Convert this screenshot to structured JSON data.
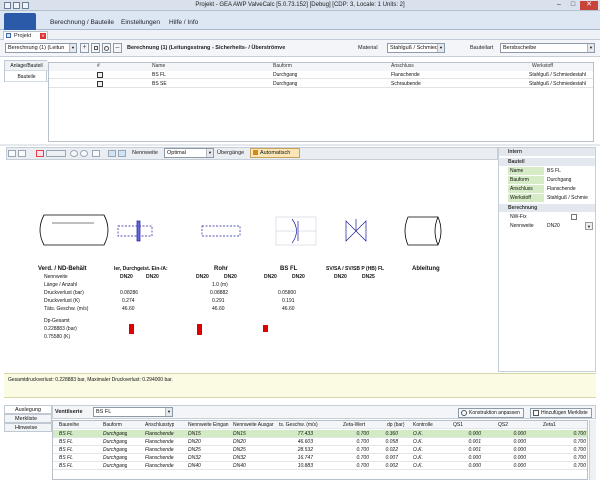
{
  "window": {
    "title": "Projekt - GEA AWP ValveCalc [5.0.73.152] [Debug] [CDP: 3, Locale: 1 Units: 2]",
    "minimize": "–",
    "maximize": "□",
    "close": "✕"
  },
  "menu": {
    "items": [
      "Berechnung / Bauteile",
      "Einstellungen",
      "Hilfe / Info"
    ]
  },
  "doc_tab": {
    "label": "Projekt",
    "close": "✕"
  },
  "project_bar": {
    "calc_select": "Berechnung (1) (Leitun",
    "plus": "+",
    "minus": "–",
    "heading": "Berechnung (1) (Leitungsstrang - Sicherheits- / Überströmve",
    "material_label": "Material",
    "material_value": "Stahlguß / Schmied",
    "bauteil_label": "Bauteilart",
    "bauteil_value": "Bersbscheibe"
  },
  "side_tabs": [
    "Anlage/Bauteil",
    "Bauteile"
  ],
  "parts_table": {
    "headers": [
      "#",
      "Name",
      "Bauform",
      "Anschluss",
      "Werkstoff"
    ],
    "rows": [
      {
        "name": "BS FL",
        "bauform": "Durchgang",
        "anschluss": "Flanschende",
        "werkstoff": "Stahlguß / Schmiedestahl"
      },
      {
        "name": "BS SE",
        "bauform": "Durchgang",
        "anschluss": "Schraubende",
        "werkstoff": "Stahlguß / Schmiedestahl"
      }
    ]
  },
  "toolbar": {
    "nennweite_label": "Nennweite",
    "nennweite_value": "Optimal",
    "uebergaenge_label": "Übergänge",
    "auto_label": "Automatisch"
  },
  "diagram": {
    "col1": {
      "title": "Verd. / ND-Behält",
      "rows": [
        "Nennweite",
        "Länge / Anzahl",
        "Druckverlust (bar)",
        "Druckverlust (K)",
        "Täts. Geschw. (m/s)"
      ],
      "dp_gesamt": "Dp-Gesamt",
      "dp_bar": "0.228883 (bar)",
      "dp_k": "0.75580 (K)"
    },
    "col2": {
      "title": "ler, Durchgeist. Ein-/A:",
      "dn1": "DN20",
      "dn2": "DN20",
      "values": [
        "0.08286",
        "0.274",
        "46.60"
      ]
    },
    "col3": {
      "title": "Rohr",
      "dn1": "DN20",
      "dn2": "DN20",
      "values": [
        "1.0 (m)",
        "0.08882",
        "0.291",
        "46.60"
      ]
    },
    "col4": {
      "title": "BS FL",
      "dn1": "DN20",
      "dn2": "DN20",
      "values": [
        "0.05800",
        "0.191",
        "46.60"
      ]
    },
    "col5": {
      "title": "SV/SA / SV/SB P (HB) FL",
      "dn1": "DN20",
      "dn2": "DN25"
    },
    "col6": {
      "title": "Ableitung"
    }
  },
  "props": {
    "group1": "Intern",
    "group2": "Bauteil",
    "rows": [
      {
        "name": "Name",
        "value": "BS FL"
      },
      {
        "name": "Bauform",
        "value": "Durchgang"
      },
      {
        "name": "Anschluss",
        "value": "Flanschende"
      },
      {
        "name": "Werkstoff",
        "value": "Stahlguß / Schmie"
      }
    ],
    "group3": "Berechnung",
    "calc_rows": [
      {
        "name": "NW-Fix",
        "value": ""
      },
      {
        "name": "Nennweite",
        "value": "DN20"
      }
    ]
  },
  "status_message": "Gesamtdruckverlust: 0.228883 bar, Maximaler Druckverlust: 0.294000 bar.",
  "bottom_tabs": [
    "Auslegung",
    "Merkliste",
    "Hinweise"
  ],
  "variants": {
    "label": "Ventilserie",
    "value": "BS FL",
    "btn1": "Konstruktion anpassen",
    "btn2": "Hinzufügen Merkliste"
  },
  "results_table": {
    "headers": [
      "Baureihe",
      "Bauform",
      "Anschlusstyp",
      "Nennweite Eingan",
      "Nennweite Ausgar",
      "ts. Geschw. (m/s)",
      "Zeta-Wert",
      "dp (bar)",
      "Kontrolle",
      "QS1",
      "QS2",
      "Zeta1"
    ],
    "rows": [
      [
        "BS FL",
        "Durchgang",
        "Flanschende",
        "DN15",
        "DN15",
        "77.433",
        "0.700",
        "0.360",
        "O.K.",
        "0.000",
        "0.000",
        "0.700"
      ],
      [
        "BS FL",
        "Durchgang",
        "Flanschende",
        "DN20",
        "DN20",
        "46.603",
        "0.700",
        "0.058",
        "O.K.",
        "0.001",
        "0.000",
        "0.700"
      ],
      [
        "BS FL",
        "Durchgang",
        "Flanschende",
        "DN25",
        "DN25",
        "28.532",
        "0.700",
        "0.022",
        "O.K.",
        "0.001",
        "0.000",
        "0.700"
      ],
      [
        "BS FL",
        "Durchgang",
        "Flanschende",
        "DN32",
        "DN32",
        "16.747",
        "0.700",
        "0.007",
        "O.K.",
        "0.000",
        "0.000",
        "0.700"
      ],
      [
        "BS FL",
        "Durchgang",
        "Flanschende",
        "DN40",
        "DN40",
        "10.883",
        "0.700",
        "0.002",
        "O.K.",
        "0.000",
        "0.000",
        "0.700"
      ]
    ]
  }
}
